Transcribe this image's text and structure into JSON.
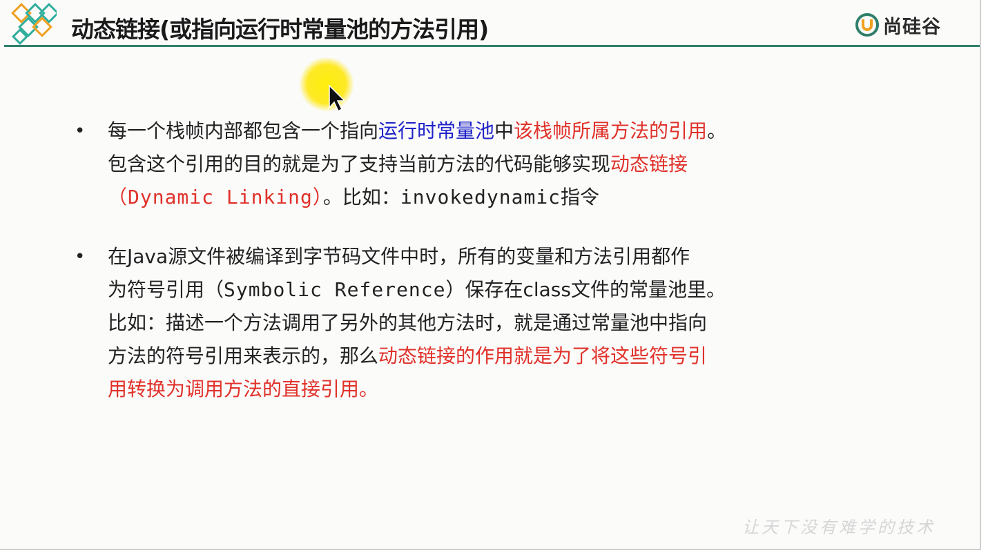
{
  "header": {
    "title": "动态链接(或指向运行时常量池的方法引用)",
    "brand_name": "尚硅谷",
    "accent_color": "#2f7f6a",
    "logo_colors": [
      "#f0a020",
      "#2fae9c"
    ]
  },
  "bullets": [
    {
      "lines": [
        [
          {
            "text": "每一个栈帧内部都包含一个指向",
            "style": "normal"
          },
          {
            "text": "运行时常量池",
            "style": "blue"
          },
          {
            "text": "中",
            "style": "normal"
          },
          {
            "text": "该栈帧所属方法的引用",
            "style": "red"
          },
          {
            "text": "。",
            "style": "normal"
          }
        ],
        [
          {
            "text": "包含这个引用的目的就是为了支持当前方法的代码能够实现",
            "style": "normal"
          },
          {
            "text": "动态链接",
            "style": "red"
          }
        ],
        [
          {
            "text": "（Dynamic Linking）",
            "style": "red mono"
          },
          {
            "text": "。比如：",
            "style": "normal"
          },
          {
            "text": "invokedynamic",
            "style": "mono"
          },
          {
            "text": "指令",
            "style": "normal"
          }
        ]
      ]
    },
    {
      "lines": [
        [
          {
            "text": "在Java源文件被编译到字节码文件中时，所有的变量和方法引用都作",
            "style": "normal"
          }
        ],
        [
          {
            "text": "为符号引用（",
            "style": "normal"
          },
          {
            "text": "Symbolic Reference",
            "style": "mono"
          },
          {
            "text": "）保存在class文件的常量池里。",
            "style": "normal"
          }
        ],
        [
          {
            "text": "比如：描述一个方法调用了另外的其他方法时，就是通过常量池中指向",
            "style": "normal"
          }
        ],
        [
          {
            "text": "方法的符号引用来表示的，那么",
            "style": "normal"
          },
          {
            "text": "动态链接的作用就是为了将这些符号引",
            "style": "red"
          }
        ],
        [
          {
            "text": "用转换为调用方法的直接引用。",
            "style": "red"
          }
        ]
      ]
    }
  ],
  "slogan": "让天下没有难学的技术",
  "icons": {
    "logo": "diamond-logo-icon",
    "brand": "brand-u-icon",
    "pointer": "mouse-pointer-icon"
  }
}
